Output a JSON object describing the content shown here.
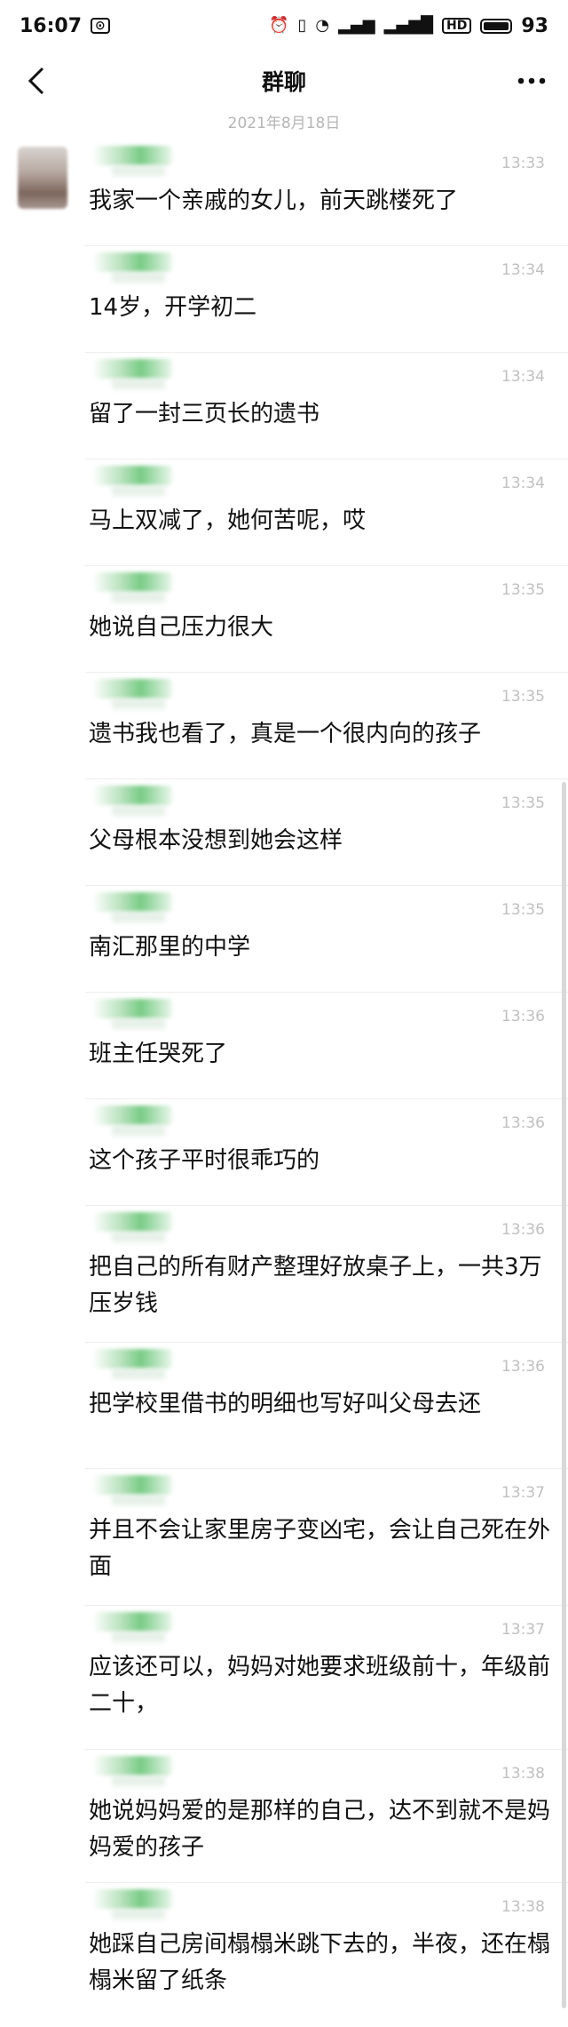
{
  "status_bar": {
    "time": "16:07",
    "icons": [
      "notification-icon",
      "alarm-icon",
      "vibrate-icon",
      "wifi-icon",
      "signal-4g-icon",
      "signal-4g-icon-2",
      "hd-icon"
    ],
    "hd_label": "HD",
    "battery": "93"
  },
  "header": {
    "back_icon": "chevron-left-icon",
    "title": "群聊",
    "more_icon": "more-dots-icon"
  },
  "date_label": "2021年8月18日",
  "messages": [
    {
      "time": "13:33",
      "text": "我家一个亲戚的女儿，前天跳楼死了"
    },
    {
      "time": "13:34",
      "text": "14岁，开学初二"
    },
    {
      "time": "13:34",
      "text": "留了一封三页长的遗书"
    },
    {
      "time": "13:34",
      "text": "马上双减了，她何苦呢，哎"
    },
    {
      "time": "13:35",
      "text": "她说自己压力很大"
    },
    {
      "time": "13:35",
      "text": "遗书我也看了，真是一个很内向的孩子"
    },
    {
      "time": "13:35",
      "text": "父母根本没想到她会这样"
    },
    {
      "time": "13:35",
      "text": "南汇那里的中学"
    },
    {
      "time": "13:36",
      "text": "班主任哭死了"
    },
    {
      "time": "13:36",
      "text": "这个孩子平时很乖巧的"
    },
    {
      "time": "13:36",
      "text": "把自己的所有财产整理好放桌子上，一共3万压岁钱"
    },
    {
      "time": "13:36",
      "text": "把学校里借书的明细也写好叫父母去还"
    },
    {
      "time": "13:37",
      "text": "并且不会让家里房子变凶宅，会让自己死在外面"
    },
    {
      "time": "13:37",
      "text": "应该还可以，妈妈对她要求班级前十，年级前二十，"
    },
    {
      "time": "13:38",
      "text": "她说妈妈爱的是那样的自己，达不到就不是妈妈爱的孩子"
    },
    {
      "time": "13:38",
      "text": "她踩自己房间榻榻米跳下去的，半夜，还在榻榻米留了纸条"
    }
  ]
}
